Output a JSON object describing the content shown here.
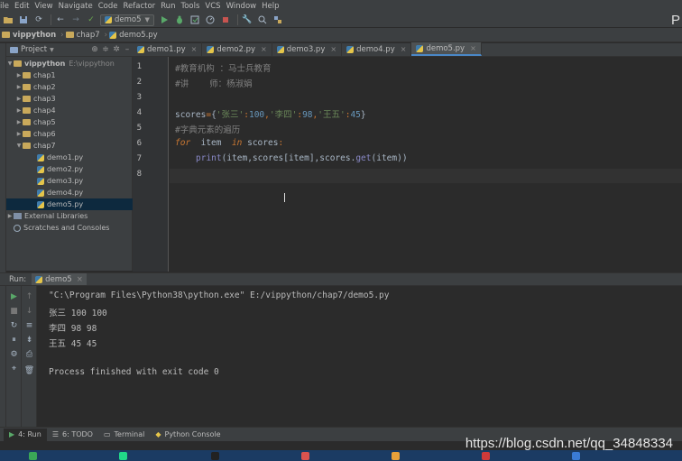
{
  "menu": [
    "ile",
    "Edit",
    "View",
    "Navigate",
    "Code",
    "Refactor",
    "Run",
    "Tools",
    "VCS",
    "Window",
    "Help"
  ],
  "toolbar": {
    "run_config": "demo5",
    "right_glyph": "P"
  },
  "breadcrumb": [
    "vippython",
    "chap7",
    "demo5.py"
  ],
  "project": {
    "title": "Project",
    "root_name": "vippython",
    "root_path": "E:\\vippython",
    "folders": [
      "chap1",
      "chap2",
      "chap3",
      "chap4",
      "chap5",
      "chap6",
      "chap7"
    ],
    "files": [
      "demo1.py",
      "demo2.py",
      "demo3.py",
      "demo4.py",
      "demo5.py"
    ],
    "external": "External Libraries",
    "scratches": "Scratches and Consoles"
  },
  "tabs": [
    "demo1.py",
    "demo2.py",
    "demo3.py",
    "demo4.py",
    "demo5.py"
  ],
  "editor": {
    "line_numbers": [
      "1",
      "2",
      "3",
      "4",
      "5",
      "6",
      "7",
      "8"
    ],
    "line1": "#教育机构 ：马士兵教育",
    "line2": "#讲    师：杨淑娟",
    "line4": {
      "var": "scores",
      "eq": "=",
      "open": "{",
      "k1": "'张三'",
      "c1": ":",
      "v1": "100",
      "s1": ",",
      "k2": "'李四'",
      "c2": ":",
      "v2": "98",
      "s2": ",",
      "k3": "'王五'",
      "c3": ":",
      "v3": "45",
      "close": "}"
    },
    "line5": "#字典元素的遍历",
    "line6": {
      "kw_for": "for",
      "var": "  item  ",
      "kw_in": "in",
      "rest": " scores",
      "colon": ":"
    },
    "line7": {
      "fn": "print",
      "args1": "(item,scores[item],scores.",
      "method": "get",
      "args2": "(item))"
    }
  },
  "run": {
    "label": "Run:",
    "tab": "demo5",
    "output": [
      "\"C:\\Program Files\\Python38\\python.exe\" E:/vippython/chap7/demo5.py",
      "张三 100 100",
      "李四 98 98",
      "王五 45 45",
      "",
      "Process finished with exit code 0"
    ]
  },
  "bottom_tabs": [
    "4: Run",
    "6: TODO",
    "Terminal",
    "Python Console"
  ],
  "watermark": "https://blog.csdn.net/qq_34848334",
  "colors": {
    "comment": "#808080",
    "string": "#6a8759",
    "number": "#6897bb",
    "keyword": "#cc7832",
    "builtin": "#8888c6",
    "selection": "#0d293e"
  }
}
